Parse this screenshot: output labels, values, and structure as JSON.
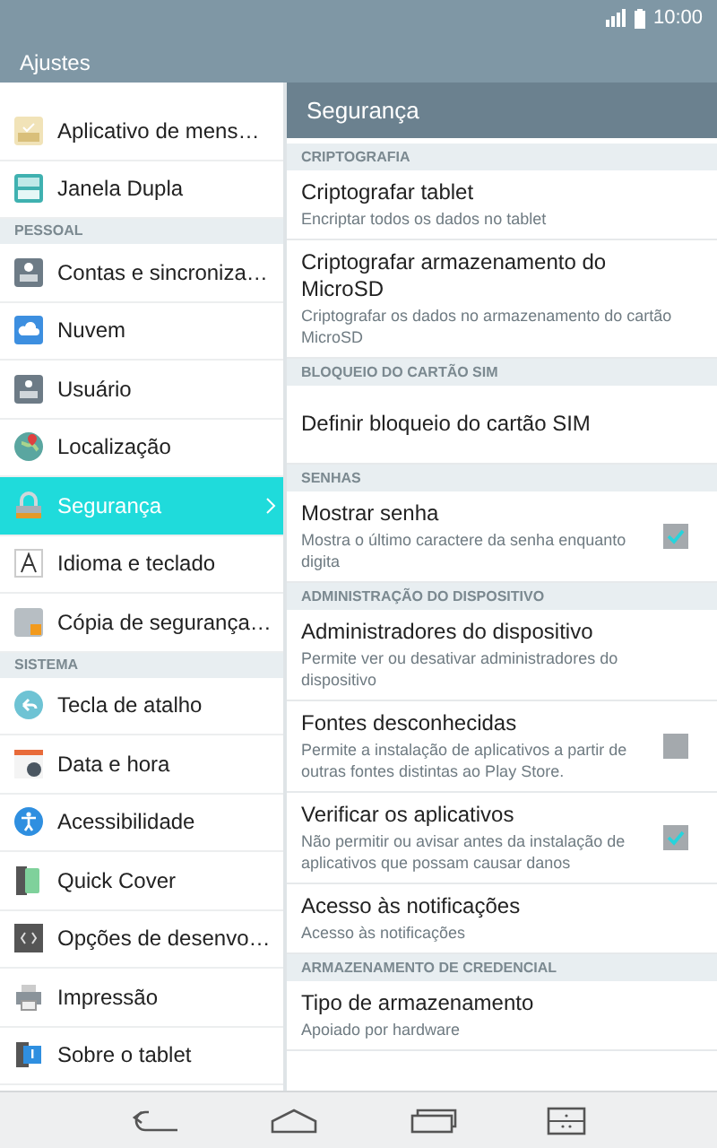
{
  "status_bar": {
    "time": "10:00"
  },
  "title_bar": {
    "title": "Ajustes"
  },
  "sidebar": {
    "items": [
      {
        "kind": "item",
        "label": "Aplicativo de mens…",
        "selected": false
      },
      {
        "kind": "item",
        "label": "Janela Dupla",
        "selected": false
      },
      {
        "kind": "header",
        "label": "PESSOAL"
      },
      {
        "kind": "item",
        "label": "Contas e sincroniza…",
        "selected": false
      },
      {
        "kind": "item",
        "label": "Nuvem",
        "selected": false
      },
      {
        "kind": "item",
        "label": "Usuário",
        "selected": false
      },
      {
        "kind": "item",
        "label": "Localização",
        "selected": false
      },
      {
        "kind": "item",
        "label": "Segurança",
        "selected": true
      },
      {
        "kind": "item",
        "label": "Idioma e teclado",
        "selected": false
      },
      {
        "kind": "item",
        "label": "Cópia de segurança…",
        "selected": false
      },
      {
        "kind": "header",
        "label": "SISTEMA"
      },
      {
        "kind": "item",
        "label": "Tecla de atalho",
        "selected": false
      },
      {
        "kind": "item",
        "label": "Data e hora",
        "selected": false
      },
      {
        "kind": "item",
        "label": "Acessibilidade",
        "selected": false
      },
      {
        "kind": "item",
        "label": "Quick Cover",
        "selected": false
      },
      {
        "kind": "item",
        "label": "Opções de desenvo…",
        "selected": false
      },
      {
        "kind": "item",
        "label": "Impressão",
        "selected": false
      },
      {
        "kind": "item",
        "label": "Sobre o tablet",
        "selected": false
      }
    ]
  },
  "detail": {
    "title": "Segurança",
    "items": [
      {
        "kind": "header",
        "label": "CRIPTOGRAFIA"
      },
      {
        "kind": "text",
        "title": "Criptografar tablet",
        "subtitle": "Encriptar todos os dados no tablet"
      },
      {
        "kind": "text",
        "title": "Criptografar armazenamento do MicroSD",
        "subtitle": "Criptografar os dados no armazenamento do cartão MicroSD"
      },
      {
        "kind": "header",
        "label": "BLOQUEIO DO CARTÃO SIM"
      },
      {
        "kind": "text",
        "title": "Definir bloqueio do cartão SIM"
      },
      {
        "kind": "header",
        "label": "SENHAS"
      },
      {
        "kind": "checkbox",
        "title": "Mostrar senha",
        "subtitle": "Mostra o último caractere da senha enquanto digita",
        "checked": true
      },
      {
        "kind": "header",
        "label": "ADMINISTRAÇÃO DO DISPOSITIVO"
      },
      {
        "kind": "text",
        "title": "Administradores do dispositivo",
        "subtitle": "Permite ver ou desativar administradores do dispositivo"
      },
      {
        "kind": "checkbox",
        "title": "Fontes desconhecidas",
        "subtitle": "Permite a instalação de aplicativos a partir de outras fontes distintas ao Play Store.",
        "checked": false
      },
      {
        "kind": "checkbox",
        "title": "Verificar os aplicativos",
        "subtitle": "Não permitir ou avisar antes da instalação de aplicativos que possam causar danos",
        "checked": true
      },
      {
        "kind": "text",
        "title": "Acesso às notificações",
        "subtitle": "Acesso às notificações"
      },
      {
        "kind": "header",
        "label": "ARMAZENAMENTO DE CREDENCIAL"
      },
      {
        "kind": "text",
        "title": "Tipo de armazenamento",
        "subtitle": "Apoiado por hardware"
      }
    ]
  }
}
